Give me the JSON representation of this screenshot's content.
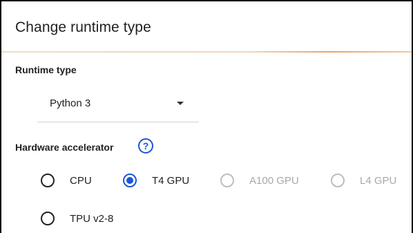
{
  "dialog": {
    "title": "Change runtime type"
  },
  "runtime": {
    "label": "Runtime type",
    "selected": "Python 3"
  },
  "hardware": {
    "label": "Hardware accelerator",
    "help_icon": "help-question-icon",
    "help_glyph": "?",
    "options": [
      {
        "label": "CPU",
        "selected": false,
        "disabled": false
      },
      {
        "label": "T4 GPU",
        "selected": true,
        "disabled": false
      },
      {
        "label": "A100 GPU",
        "selected": false,
        "disabled": true
      },
      {
        "label": "L4 GPU",
        "selected": false,
        "disabled": true
      },
      {
        "label": "TPU v2-8",
        "selected": false,
        "disabled": false
      }
    ]
  },
  "colors": {
    "accent": "#1a56d6",
    "disabled": "#a8a8a8",
    "text": "#202124"
  }
}
